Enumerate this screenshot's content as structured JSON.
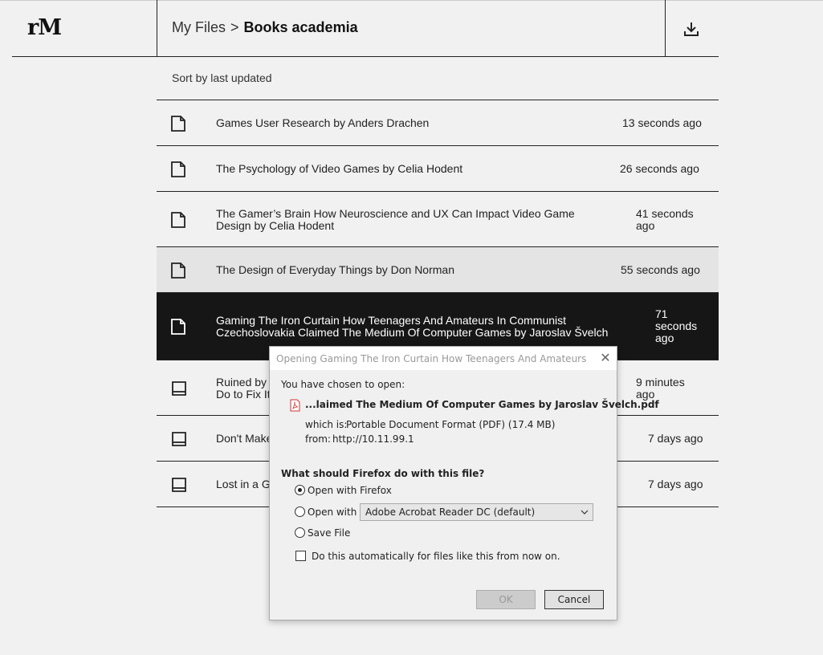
{
  "header": {
    "logo": "rM",
    "breadcrumb_root": "My Files",
    "breadcrumb_separator": ">",
    "breadcrumb_current": "Books academia",
    "download_icon": "download-icon"
  },
  "sort_label": "Sort by last updated",
  "files": [
    {
      "title_lines": [
        "Games User Research by Anders Drachen"
      ],
      "time_lines": [
        "13 seconds ago"
      ],
      "icon": "document-icon"
    },
    {
      "title_lines": [
        "The Psychology of Video Games by Celia Hodent"
      ],
      "time_lines": [
        "26 seconds ago"
      ],
      "icon": "document-icon"
    },
    {
      "title_lines": [
        "The Gamer’s Brain How Neuroscience and UX Can Impact Video Game",
        "Design by Celia Hodent"
      ],
      "time_lines": [
        "41 seconds",
        "ago"
      ],
      "icon": "document-icon"
    },
    {
      "title_lines": [
        "The Design of Everyday Things by Don Norman"
      ],
      "time_lines": [
        "55 seconds ago"
      ],
      "icon": "document-icon",
      "state": "hover"
    },
    {
      "title_lines": [
        "Gaming The Iron Curtain How Teenagers And Amateurs In Communist",
        "Czechoslovakia Claimed The Medium Of Computer Games by Jaroslav Švelch"
      ],
      "time_lines": [
        "71",
        "seconds",
        "ago"
      ],
      "icon": "document-icon",
      "state": "selected"
    },
    {
      "title_lines": [
        "Ruined by",
        "Do to Fix It"
      ],
      "time_lines": [
        "9 minutes",
        "ago"
      ],
      "icon": "book-icon"
    },
    {
      "title_lines": [
        "Don't Make"
      ],
      "time_lines": [
        "7 days ago"
      ],
      "icon": "book-icon"
    },
    {
      "title_lines": [
        "Lost in a G"
      ],
      "time_lines": [
        "7 days ago"
      ],
      "icon": "book-icon"
    }
  ],
  "dialog": {
    "title": "Opening Gaming The Iron Curtain How Teenagers And Amateurs In Co...",
    "chosen_label": "You have chosen to open:",
    "filename": "...laimed The Medium Of Computer Games by Jaroslav Švelch.pdf",
    "which_is_label": "which is:",
    "which_is_value": "Portable Document Format (PDF) (17.4 MB)",
    "from_label": "from:",
    "from_value": "http://10.11.99.1",
    "question": "What should Firefox do with this file?",
    "option_open_firefox": "Open with Firefox",
    "option_open_with": "Open with",
    "open_with_app": "Adobe Acrobat Reader DC (default)",
    "option_save": "Save File",
    "auto_checkbox": "Do this automatically for files like this from now on.",
    "ok_label": "OK",
    "cancel_label": "Cancel",
    "selected_option": "Open with Firefox"
  },
  "colors": {
    "background": "#f1f1f1",
    "selected_row": "#161616",
    "hover_row": "#e4e4e4",
    "dialog_bg": "#f0f0f0"
  }
}
